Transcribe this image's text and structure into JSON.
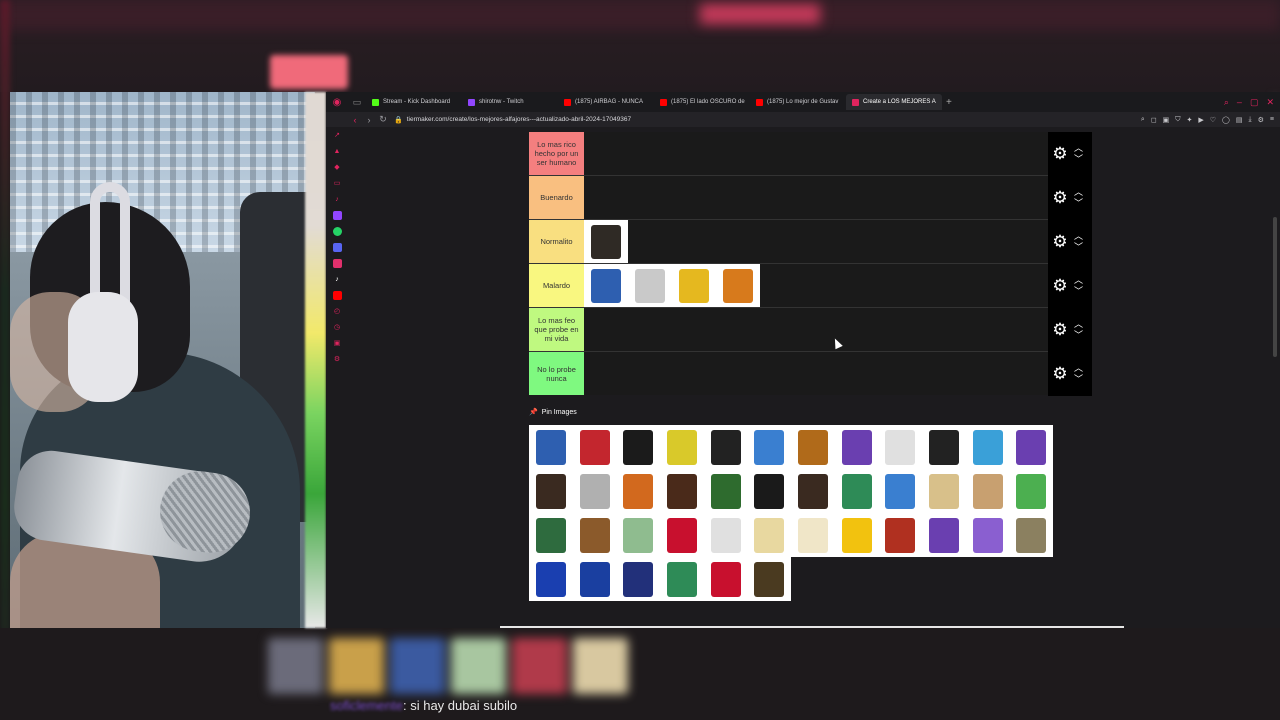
{
  "tabs": [
    {
      "label": "Stream - Kick Dashboard",
      "color": "#53fc18"
    },
    {
      "label": "shirotnw - Twitch",
      "color": "#9146ff"
    },
    {
      "label": "(1875) AIRBAG - NUNCA",
      "color": "#ff0000"
    },
    {
      "label": "(1875) El lado OSCURO de",
      "color": "#ff0000"
    },
    {
      "label": "(1875) Lo mejor de Gustav",
      "color": "#ff0000"
    },
    {
      "label": "Create a LOS MEJORES A",
      "color": "#e0245e",
      "active": true
    }
  ],
  "url": "tiermaker.com/create/los-mejores-alfajores---actualizado-abril-2024-17049367",
  "tiers": [
    {
      "label": "Lo mas rico hecho por un ser humano",
      "color": "#f47f7f",
      "items": []
    },
    {
      "label": "Buenardo",
      "color": "#f9bf80",
      "items": []
    },
    {
      "label": "Normalito",
      "color": "#f9df80",
      "items": [
        "#2f2a25"
      ]
    },
    {
      "label": "Malardo",
      "color": "#f9f780",
      "items": [
        "#2e5fb0",
        "#c9c9c9",
        "#e5b81f",
        "#d77a1c"
      ]
    },
    {
      "label": "Lo mas feo que probe en mi vida",
      "color": "#bff980",
      "items": []
    },
    {
      "label": "No lo probe nunca",
      "color": "#7ff980",
      "items": []
    }
  ],
  "pin_label": "Pin Images",
  "pool_items": [
    "#2e5fb0",
    "#c3262e",
    "#1b1b1b",
    "#d9c92a",
    "#222222",
    "#3a7fd0",
    "#b06a1a",
    "#6a3fb0",
    "#e0e0e0",
    "#222222",
    "#3aa0d8",
    "#6a3fb0",
    "#3a2a20",
    "#b0b0b0",
    "#d2691e",
    "#4a2a1a",
    "#2e6b2e",
    "#1a1a1a",
    "#3a2a20",
    "#2e8b57",
    "#3a7fd0",
    "#d8c08a",
    "#c8a070",
    "#4caf50",
    "#2e6b3e",
    "#8b5a2b",
    "#8fbc8f",
    "#c8102e",
    "#e0e0e0",
    "#e8d8a0",
    "#f0e6c8",
    "#f2c20f",
    "#b03020",
    "#6a3fb0",
    "#8a5fd0",
    "#8b8060",
    "#1a3fb0",
    "#1a3fa0",
    "#22307a",
    "#2e8b57",
    "#c8102e",
    "#4a3a20"
  ],
  "chat": {
    "user": "soficlemente",
    "message": ": si hay dubai subilo"
  }
}
